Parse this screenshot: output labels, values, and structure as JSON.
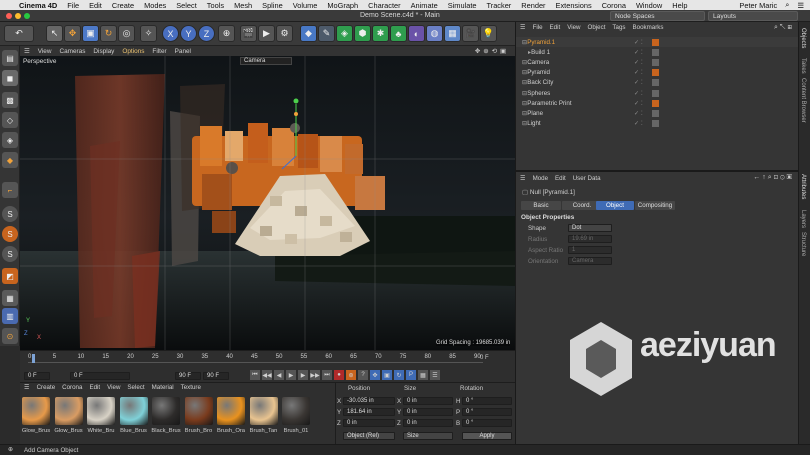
{
  "menubar": {
    "app": "Cinema 4D",
    "items": [
      "File",
      "Edit",
      "Create",
      "Modes",
      "Select",
      "Tools",
      "Mesh",
      "Spline",
      "Volume",
      "MoGraph",
      "Character",
      "Animate",
      "Simulate",
      "Tracker",
      "Render",
      "Extensions",
      "Corona",
      "Window",
      "Help"
    ],
    "user": "Peter Maric"
  },
  "titlebar": {
    "title": "Demo Scene.c4d * - Main",
    "node_spaces": "Node Spaces",
    "layouts": "Layouts"
  },
  "toolbar": {
    "undo": "↶",
    "axes": [
      "X",
      "Y",
      "Z"
    ]
  },
  "viewport": {
    "menu": [
      "View",
      "Cameras",
      "Display",
      "Options",
      "Filter",
      "Panel"
    ],
    "name": "Perspective",
    "camera": "Camera",
    "grid_spacing": "Grid Spacing : 19685.039 in",
    "axis_y": "Y",
    "axis_z": "Z",
    "axis_x": "X"
  },
  "timeline": {
    "ticks": [
      "0",
      "5",
      "10",
      "15",
      "20",
      "25",
      "30",
      "35",
      "40",
      "45",
      "50",
      "55",
      "60",
      "65",
      "70",
      "75",
      "80",
      "85",
      "90"
    ],
    "current": "0 F",
    "start": "0 F",
    "start2": "0 F",
    "end": "90 F",
    "end2": "90 F",
    "frame_field": "0 F"
  },
  "materials": {
    "menu": [
      "Create",
      "Corona",
      "Edit",
      "View",
      "Select",
      "Material",
      "Texture"
    ],
    "items": [
      {
        "name": "Glow_Brus",
        "color": "#e79a4a"
      },
      {
        "name": "Glow_Brus",
        "color": "#d99c63"
      },
      {
        "name": "White_Bru",
        "color": "#d8d2c6"
      },
      {
        "name": "Blue_Brus",
        "color": "#7fd1d8"
      },
      {
        "name": "Black_Brus",
        "color": "#2d2b2a"
      },
      {
        "name": "Brush_Bro",
        "color": "#7a3b1d"
      },
      {
        "name": "Brush_Ora",
        "color": "#e9921f"
      },
      {
        "name": "Brush_Tan",
        "color": "#e9c490"
      },
      {
        "name": "Brush_01",
        "color": "#3a3633"
      }
    ]
  },
  "coords": {
    "headers": [
      "Position",
      "Size",
      "Rotation"
    ],
    "rows": [
      {
        "axis": "X",
        "pos": "-30.035 in",
        "size_axis": "X",
        "size": "0 in",
        "rot_axis": "H",
        "rot": "0 °"
      },
      {
        "axis": "Y",
        "pos": "181.64 in",
        "size_axis": "Y",
        "size": "0 in",
        "rot_axis": "P",
        "rot": "0 °"
      },
      {
        "axis": "Z",
        "pos": "0 in",
        "size_axis": "Z",
        "size": "0 in",
        "rot_axis": "B",
        "rot": "0 °"
      }
    ],
    "mode": "Object (Rel)",
    "size_mode": "Size",
    "apply": "Apply"
  },
  "status": {
    "text": "Add Camera Object"
  },
  "objects": {
    "menu": [
      "File",
      "Edit",
      "View",
      "Object",
      "Tags",
      "Bookmarks"
    ],
    "items": [
      {
        "name": "Pyramid.1",
        "selected": true,
        "level": 0
      },
      {
        "name": "Build 1",
        "level": 1
      },
      {
        "name": "Camera",
        "level": 0
      },
      {
        "name": "Pyramid",
        "level": 0
      },
      {
        "name": "Back City",
        "level": 0
      },
      {
        "name": "Spheres",
        "level": 0
      },
      {
        "name": "Parametric Print",
        "level": 0
      },
      {
        "name": "Plane",
        "level": 0
      },
      {
        "name": "Light",
        "level": 0
      }
    ]
  },
  "attributes": {
    "menu": [
      "Mode",
      "Edit",
      "User Data"
    ],
    "object": "Null [Pyramid.1]",
    "tabs": [
      "Basic",
      "Coord.",
      "Object",
      "Compositing"
    ],
    "active_tab": "Object",
    "section": "Object Properties",
    "fields": [
      {
        "label": "Shape",
        "value": "Dot",
        "enabled": true
      },
      {
        "label": "Radius",
        "value": "19.69 in",
        "enabled": false
      },
      {
        "label": "Aspect Ratio",
        "value": "1",
        "enabled": false
      },
      {
        "label": "Orientation",
        "value": "Camera",
        "enabled": false
      }
    ]
  },
  "sidetabs": [
    "Objects",
    "Takes",
    "Content Browser",
    "Attributes",
    "Layers",
    "Structure"
  ],
  "watermark": {
    "brand": "aeziyuan",
    ".com": ".com"
  }
}
